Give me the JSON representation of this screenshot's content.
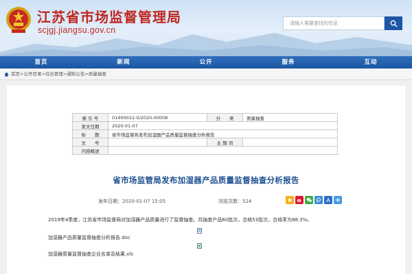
{
  "site": {
    "title": "江苏省市场监督管理局",
    "domain": "scjgj.jiangsu.gov.cn"
  },
  "search": {
    "placeholder": "请输入需要查找的信息"
  },
  "nav": [
    "首页",
    "新闻",
    "公开",
    "服务",
    "互动"
  ],
  "breadcrumb": [
    "首页",
    "公开目录",
    "综合管理",
    "通知公告",
    "质量抽查"
  ],
  "meta": {
    "index_label": "索 引 号",
    "index_value": "01400022-0/2020-00008",
    "category_label": "分　　类",
    "category_value": "质量抽查",
    "date_label": "发文日期",
    "date_value": "2020-01-07",
    "title_label": "标　　题",
    "title_value": "省市场监督局发布加湿器产品质量监督抽查分析报告",
    "docno_label": "文　　号",
    "docno_value": "",
    "subject_label": "主 题 词",
    "subject_value": "",
    "summary_label": "内容概述",
    "summary_value": ""
  },
  "article": {
    "title": "省市场监管局发布加湿器产品质量监督抽查分析报告",
    "publish_label": "发布日期：",
    "publish_time": "2020-01-07 15:05",
    "views_label": "浏览次数：",
    "views_count": "524",
    "summary": "2019年4季度，江苏省市场监督局对加湿器产品质量进行了监督抽查。共抽查产品60批次，合格53批次，合格率为88.3%。",
    "attachments": [
      "加湿器产品质量监督抽查分析报告.doc",
      "加湿器质量监督抽查企业名单及结果.xls"
    ]
  },
  "share_icons": [
    "qzone-icon",
    "weibo-icon",
    "wechat-icon",
    "tencent-weibo-icon",
    "renren-icon",
    "more-share-icon"
  ],
  "colors": {
    "brand_red": "#c0261f",
    "nav_blue": "#1b56a2",
    "title_blue": "#1d4f91"
  }
}
